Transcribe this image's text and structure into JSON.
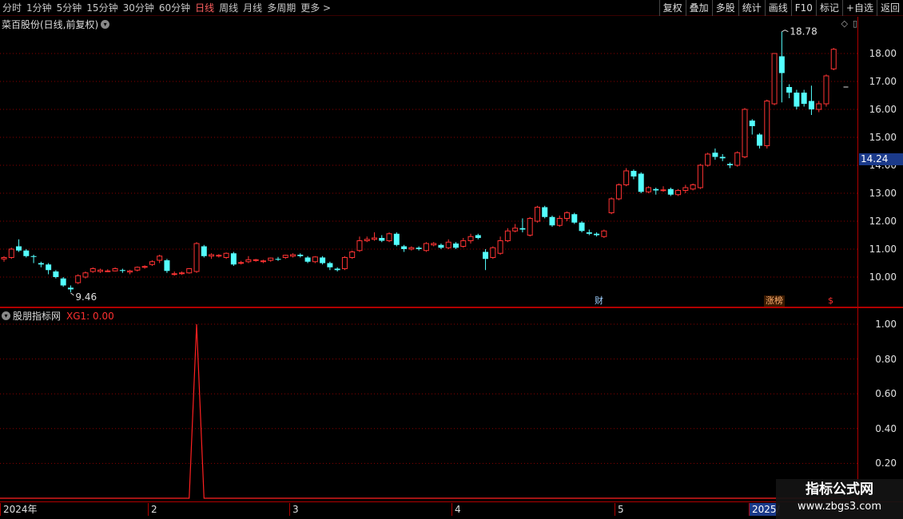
{
  "toolbar": {
    "periods": [
      "分时",
      "1分钟",
      "5分钟",
      "15分钟",
      "30分钟",
      "60分钟",
      "日线",
      "周线",
      "月线",
      "多周期",
      "更多 >"
    ],
    "active_period": "日线",
    "buttons": [
      "复权",
      "叠加",
      "多股",
      "统计",
      "画线",
      "F10",
      "标记",
      "+自选",
      "返回"
    ]
  },
  "price_panel": {
    "title": "菜百股份(日线,前复权)",
    "high_label": "18.78",
    "low_label": "9.46",
    "current_price": "14.24",
    "axis_ticks": [
      "18.00",
      "17.00",
      "16.00",
      "15.00",
      "14.00",
      "13.00",
      "12.00",
      "11.00",
      "10.00"
    ],
    "markers": [
      {
        "text": "财",
        "kind": "cai"
      },
      {
        "text": "涨榜",
        "kind": "zb"
      },
      {
        "text": "$",
        "kind": "s"
      }
    ],
    "colors": {
      "up": "#ff3333",
      "down": "#54ffff",
      "grid": "#8b0000"
    }
  },
  "indicator_panel": {
    "title": "股朋指标网",
    "value_text": "XG1: 0.00",
    "axis_ticks": [
      "1.00",
      "0.80",
      "0.60",
      "0.40",
      "0.20"
    ]
  },
  "date_axis": {
    "labels": [
      "2024年",
      "2",
      "3",
      "4",
      "5",
      "2025/"
    ]
  },
  "watermark": {
    "line1": "指标公式网",
    "line2": "www.zbgs3.com"
  },
  "chart_data": {
    "type": "candlestick",
    "price_range": [
      9.0,
      19.0
    ],
    "candles": [
      [
        10.65,
        10.7,
        10.55,
        10.75
      ],
      [
        10.7,
        11.0,
        10.65,
        11.05
      ],
      [
        11.1,
        10.95,
        10.9,
        11.35
      ],
      [
        10.95,
        10.75,
        10.7,
        11.0
      ],
      [
        10.75,
        10.72,
        10.5,
        10.8
      ],
      [
        10.5,
        10.45,
        10.35,
        10.55
      ],
      [
        10.45,
        10.25,
        10.1,
        10.5
      ],
      [
        10.2,
        10.0,
        9.95,
        10.25
      ],
      [
        9.95,
        9.7,
        9.65,
        10.0
      ],
      [
        9.62,
        9.56,
        9.46,
        9.7
      ],
      [
        9.8,
        10.05,
        9.75,
        10.1
      ],
      [
        10.0,
        10.15,
        9.95,
        10.2
      ],
      [
        10.2,
        10.3,
        10.15,
        10.35
      ],
      [
        10.2,
        10.25,
        10.15,
        10.3
      ],
      [
        10.2,
        10.22,
        10.18,
        10.28
      ],
      [
        10.22,
        10.3,
        10.2,
        10.35
      ],
      [
        10.25,
        10.22,
        10.15,
        10.3
      ],
      [
        10.18,
        10.22,
        10.1,
        10.26
      ],
      [
        10.25,
        10.35,
        10.2,
        10.38
      ],
      [
        10.35,
        10.38,
        10.3,
        10.42
      ],
      [
        10.45,
        10.55,
        10.4,
        10.6
      ],
      [
        10.6,
        10.75,
        10.5,
        10.8
      ],
      [
        10.6,
        10.22,
        10.15,
        10.65
      ],
      [
        10.1,
        10.12,
        10.05,
        10.2
      ],
      [
        10.12,
        10.15,
        10.08,
        10.2
      ],
      [
        10.15,
        10.3,
        10.12,
        10.32
      ],
      [
        10.2,
        11.2,
        10.15,
        11.25
      ],
      [
        11.1,
        10.75,
        10.7,
        11.15
      ],
      [
        10.75,
        10.8,
        10.65,
        10.85
      ],
      [
        10.75,
        10.78,
        10.7,
        10.82
      ],
      [
        10.7,
        10.85,
        10.65,
        10.88
      ],
      [
        10.85,
        10.45,
        10.4,
        10.9
      ],
      [
        10.5,
        10.52,
        10.45,
        10.58
      ],
      [
        10.55,
        10.62,
        10.5,
        10.75
      ],
      [
        10.6,
        10.62,
        10.55,
        10.65
      ],
      [
        10.55,
        10.58,
        10.5,
        10.62
      ],
      [
        10.6,
        10.68,
        10.55,
        10.7
      ],
      [
        10.65,
        10.62,
        10.58,
        10.72
      ],
      [
        10.7,
        10.78,
        10.65,
        10.8
      ],
      [
        10.75,
        10.8,
        10.7,
        10.85
      ],
      [
        10.8,
        10.75,
        10.7,
        10.85
      ],
      [
        10.7,
        10.55,
        10.5,
        10.75
      ],
      [
        10.55,
        10.72,
        10.5,
        10.75
      ],
      [
        10.7,
        10.5,
        10.45,
        10.75
      ],
      [
        10.5,
        10.35,
        10.25,
        10.55
      ],
      [
        10.3,
        10.25,
        10.2,
        10.35
      ],
      [
        10.3,
        10.7,
        10.25,
        10.75
      ],
      [
        10.7,
        10.9,
        10.65,
        10.95
      ],
      [
        10.95,
        11.3,
        10.9,
        11.45
      ],
      [
        11.3,
        11.35,
        11.25,
        11.45
      ],
      [
        11.35,
        11.4,
        11.3,
        11.6
      ],
      [
        11.4,
        11.3,
        11.25,
        11.5
      ],
      [
        11.3,
        11.55,
        11.25,
        11.6
      ],
      [
        11.55,
        11.15,
        11.1,
        11.6
      ],
      [
        11.1,
        11.0,
        10.9,
        11.15
      ],
      [
        11.0,
        11.05,
        10.95,
        11.1
      ],
      [
        11.05,
        11.0,
        10.95,
        11.1
      ],
      [
        10.95,
        11.2,
        10.9,
        11.25
      ],
      [
        11.15,
        11.2,
        11.1,
        11.25
      ],
      [
        11.15,
        11.05,
        11.0,
        11.2
      ],
      [
        11.05,
        11.25,
        11.0,
        11.35
      ],
      [
        11.2,
        11.05,
        11.0,
        11.25
      ],
      [
        11.1,
        11.3,
        11.05,
        11.4
      ],
      [
        11.3,
        11.45,
        11.2,
        11.55
      ],
      [
        11.5,
        11.4,
        11.35,
        11.55
      ],
      [
        10.9,
        10.65,
        10.25,
        11.0
      ],
      [
        10.7,
        11.05,
        10.65,
        11.1
      ],
      [
        10.85,
        11.3,
        10.8,
        11.45
      ],
      [
        11.3,
        11.65,
        11.25,
        11.75
      ],
      [
        11.65,
        11.75,
        11.6,
        11.9
      ],
      [
        11.75,
        11.7,
        11.6,
        12.1
      ],
      [
        11.5,
        12.1,
        11.45,
        12.15
      ],
      [
        12.0,
        12.5,
        11.95,
        12.55
      ],
      [
        12.5,
        12.15,
        12.1,
        12.55
      ],
      [
        12.15,
        11.85,
        11.8,
        12.2
      ],
      [
        11.85,
        12.1,
        11.8,
        12.2
      ],
      [
        12.1,
        12.3,
        12.0,
        12.35
      ],
      [
        12.25,
        11.95,
        11.9,
        12.3
      ],
      [
        11.95,
        11.65,
        11.6,
        12.0
      ],
      [
        11.6,
        11.55,
        11.5,
        11.7
      ],
      [
        11.55,
        11.5,
        11.45,
        11.6
      ],
      [
        11.45,
        11.65,
        11.4,
        11.7
      ],
      [
        12.3,
        12.8,
        12.25,
        12.85
      ],
      [
        12.8,
        13.3,
        12.75,
        13.35
      ],
      [
        13.3,
        13.8,
        13.25,
        13.9
      ],
      [
        13.8,
        13.6,
        13.5,
        13.85
      ],
      [
        13.7,
        13.05,
        13.0,
        13.75
      ],
      [
        13.05,
        13.2,
        13.0,
        13.25
      ],
      [
        13.15,
        13.1,
        12.95,
        13.2
      ],
      [
        13.1,
        13.12,
        13.05,
        13.25
      ],
      [
        13.15,
        12.95,
        12.9,
        13.2
      ],
      [
        12.95,
        13.1,
        12.9,
        13.15
      ],
      [
        13.1,
        13.2,
        13.0,
        13.3
      ],
      [
        13.15,
        13.3,
        13.1,
        13.35
      ],
      [
        13.2,
        14.0,
        13.15,
        14.05
      ],
      [
        14.0,
        14.4,
        13.95,
        14.45
      ],
      [
        14.45,
        14.3,
        14.2,
        14.6
      ],
      [
        14.3,
        14.25,
        14.15,
        14.4
      ],
      [
        14.05,
        14.0,
        13.9,
        14.1
      ],
      [
        14.0,
        14.45,
        13.95,
        14.5
      ],
      [
        14.3,
        16.0,
        14.25,
        16.05
      ],
      [
        15.6,
        15.4,
        15.1,
        15.65
      ],
      [
        15.1,
        14.7,
        14.6,
        15.15
      ],
      [
        14.7,
        16.3,
        14.6,
        16.35
      ],
      [
        16.2,
        18.0,
        16.15,
        18.0
      ],
      [
        17.9,
        17.3,
        16.25,
        18.78
      ],
      [
        16.8,
        16.6,
        16.4,
        16.9
      ],
      [
        16.6,
        16.1,
        16.0,
        16.7
      ],
      [
        16.6,
        16.2,
        16.1,
        16.7
      ],
      [
        16.3,
        16.0,
        15.8,
        16.85
      ],
      [
        16.0,
        16.2,
        15.9,
        16.3
      ],
      [
        16.2,
        17.2,
        16.1,
        17.25
      ],
      [
        17.45,
        18.15,
        17.4,
        18.2
      ]
    ],
    "last_dash": 16.8,
    "indicator": {
      "name": "XG1",
      "ylim": [
        0,
        1.0
      ],
      "spike_index": 26,
      "spike_value": 1.0
    }
  }
}
